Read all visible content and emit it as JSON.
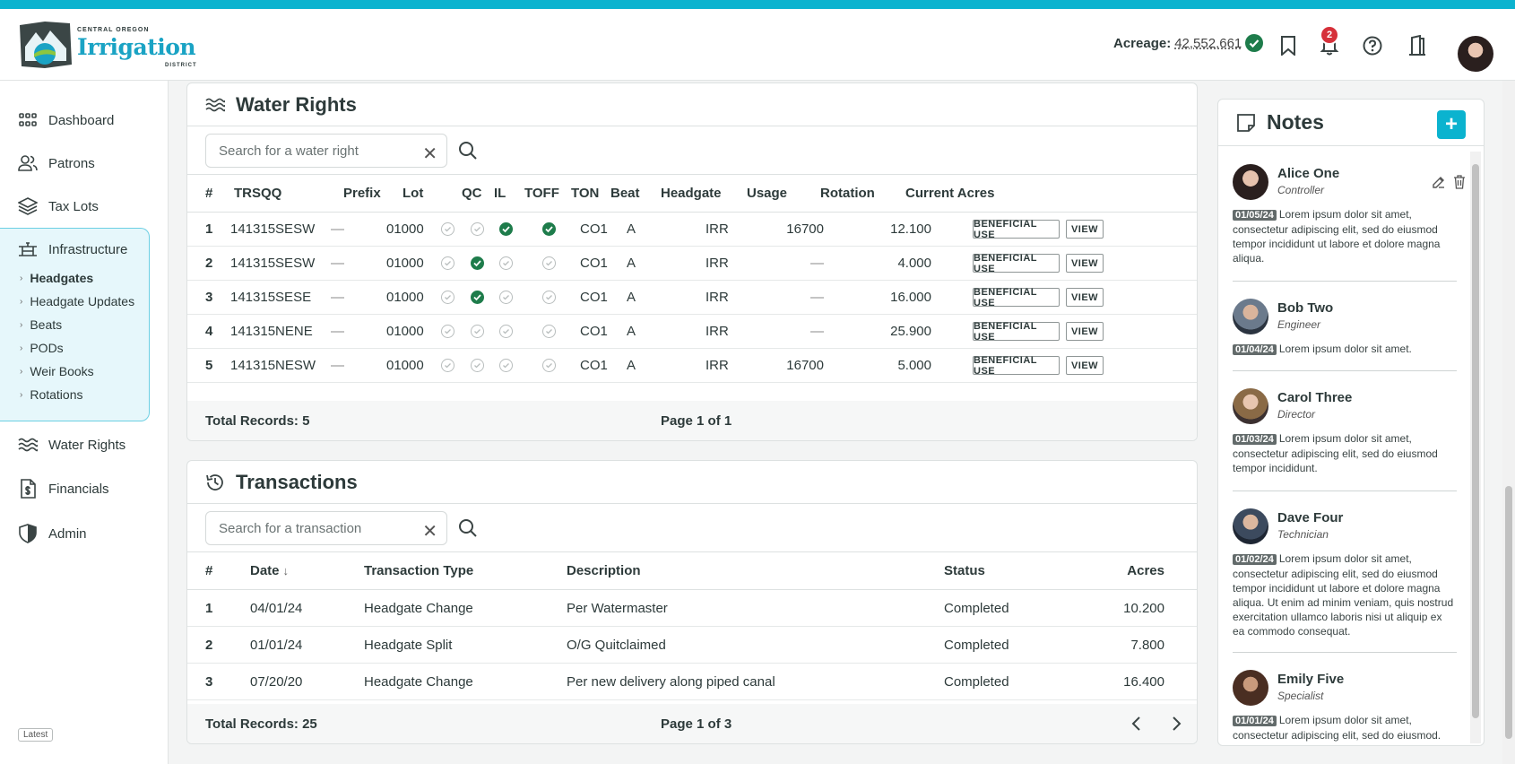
{
  "header": {
    "logo": {
      "top_text": "CENTRAL OREGON",
      "main_text": "Irrigation",
      "sub_text": "DISTRICT"
    },
    "acreage_label": "Acreage:",
    "acreage_value": "42,552.661",
    "notification_count": "2",
    "icons": [
      "bookmark-icon",
      "bell-icon",
      "help-icon",
      "logout-icon"
    ]
  },
  "sidebar": {
    "items": [
      {
        "label": "Dashboard",
        "icon": "dashboard-icon"
      },
      {
        "label": "Patrons",
        "icon": "users-icon"
      },
      {
        "label": "Tax Lots",
        "icon": "layers-icon"
      },
      {
        "label": "Infrastructure",
        "icon": "infrastructure-icon"
      },
      {
        "label": "Water Rights",
        "icon": "waves-icon"
      },
      {
        "label": "Financials",
        "icon": "invoice-icon"
      },
      {
        "label": "Admin",
        "icon": "shield-icon"
      }
    ],
    "infrastructure_sub": [
      "Headgates",
      "Headgate Updates",
      "Beats",
      "PODs",
      "Weir Books",
      "Rotations"
    ],
    "active_sub": "Headgates",
    "version_label": "Latest"
  },
  "water_rights": {
    "title": "Water Rights",
    "search_placeholder": "Search for a water right",
    "columns": [
      "#",
      "TRSQQ",
      "Prefix",
      "Lot",
      "QC",
      "IL",
      "TOFF",
      "TON",
      "Beat",
      "Headgate",
      "Usage",
      "Rotation",
      "Current Acres"
    ],
    "rows": [
      {
        "num": "1",
        "trsqq": "141315SESW",
        "prefix": "—",
        "lot": "01000",
        "qc": false,
        "il": false,
        "toff": true,
        "ton": true,
        "beat": "CO1",
        "headgate": "A",
        "usage": "IRR",
        "rotation": "16700",
        "acres": "12.100"
      },
      {
        "num": "2",
        "trsqq": "141315SESW",
        "prefix": "—",
        "lot": "01000",
        "qc": false,
        "il": true,
        "toff": false,
        "ton": false,
        "beat": "CO1",
        "headgate": "A",
        "usage": "IRR",
        "rotation": "—",
        "acres": "4.000"
      },
      {
        "num": "3",
        "trsqq": "141315SESE",
        "prefix": "—",
        "lot": "01000",
        "qc": false,
        "il": true,
        "toff": false,
        "ton": false,
        "beat": "CO1",
        "headgate": "A",
        "usage": "IRR",
        "rotation": "—",
        "acres": "16.000"
      },
      {
        "num": "4",
        "trsqq": "141315NENE",
        "prefix": "—",
        "lot": "01000",
        "qc": false,
        "il": false,
        "toff": false,
        "ton": false,
        "beat": "CO1",
        "headgate": "A",
        "usage": "IRR",
        "rotation": "—",
        "acres": "25.900"
      },
      {
        "num": "5",
        "trsqq": "141315NESW",
        "prefix": "—",
        "lot": "01000",
        "qc": false,
        "il": false,
        "toff": false,
        "ton": false,
        "beat": "CO1",
        "headgate": "A",
        "usage": "IRR",
        "rotation": "16700",
        "acres": "5.000"
      }
    ],
    "beneficial_label": "BENEFICIAL USE",
    "view_label": "VIEW",
    "total_records": "Total Records: 5",
    "page_info": "Page 1 of 1"
  },
  "transactions": {
    "title": "Transactions",
    "search_placeholder": "Search for a transaction",
    "columns": [
      "#",
      "Date",
      "Transaction Type",
      "Description",
      "Status",
      "Acres"
    ],
    "sort_indicator": "↓",
    "rows": [
      {
        "num": "1",
        "date": "04/01/24",
        "type": "Headgate Change",
        "description": "Per Watermaster",
        "status": "Completed",
        "acres": "10.200"
      },
      {
        "num": "2",
        "date": "01/01/24",
        "type": "Headgate Split",
        "description": "O/G Quitclaimed",
        "status": "Completed",
        "acres": "7.800"
      },
      {
        "num": "3",
        "date": "07/20/20",
        "type": "Headgate Change",
        "description": "Per new delivery along piped canal",
        "status": "Completed",
        "acres": "16.400"
      }
    ],
    "total_records": "Total Records: 25",
    "page_info": "Page 1 of 3"
  },
  "notes": {
    "title": "Notes",
    "add_label": "+",
    "items": [
      {
        "name": "Alice One",
        "role": "Controller",
        "date": "01/05/24",
        "text": "Lorem ipsum dolor sit amet, consectetur adipiscing elit, sed do eiusmod tempor incididunt ut labore et dolore magna aliqua."
      },
      {
        "name": "Bob Two",
        "role": "Engineer",
        "date": "01/04/24",
        "text": "Lorem ipsum dolor sit amet."
      },
      {
        "name": "Carol Three",
        "role": "Director",
        "date": "01/03/24",
        "text": "Lorem ipsum dolor sit amet, consectetur adipiscing elit, sed do eiusmod tempor incididunt."
      },
      {
        "name": "Dave Four",
        "role": "Technician",
        "date": "01/02/24",
        "text": "Lorem ipsum dolor sit amet, consectetur adipiscing elit, sed do eiusmod tempor incididunt ut labore et dolore magna aliqua. Ut enim ad minim veniam, quis nostrud exercitation ullamco laboris nisi ut aliquip ex ea commodo consequat."
      },
      {
        "name": "Emily Five",
        "role": "Specialist",
        "date": "01/01/24",
        "text": "Lorem ipsum dolor sit amet, consectetur adipiscing elit, sed do eiusmod."
      }
    ]
  },
  "colors": {
    "accent": "#0bb3cf",
    "check_on": "#1e7c4b",
    "badge": "#d6303a"
  }
}
